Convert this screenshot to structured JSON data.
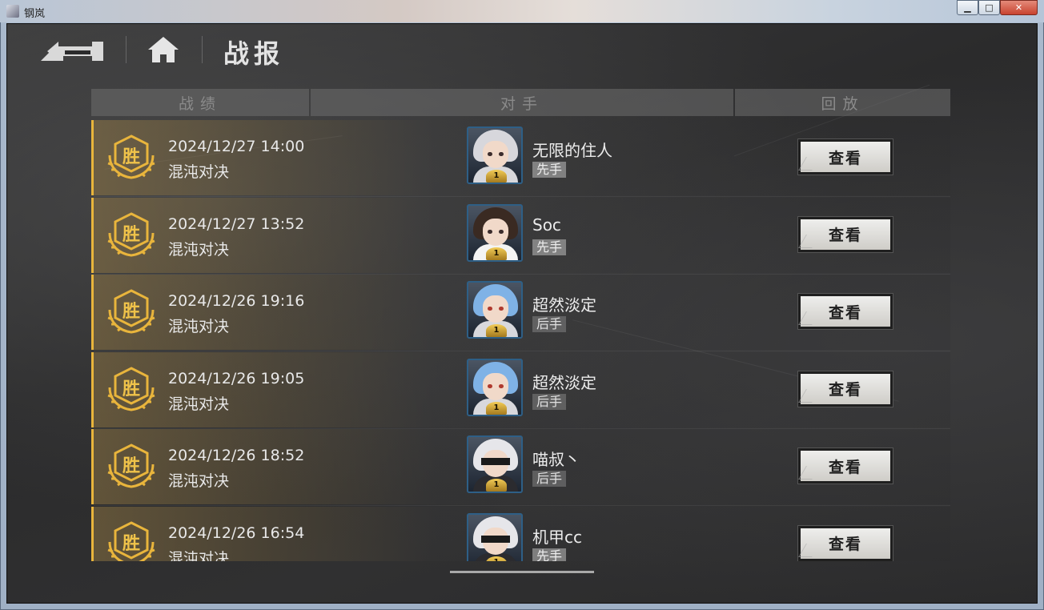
{
  "window": {
    "title": "钢岚",
    "minimize": "▁",
    "maximize": "□",
    "close": "✕"
  },
  "page": {
    "title": "战报"
  },
  "table": {
    "headers": [
      "战绩",
      "对手",
      "回放"
    ],
    "rows": [
      {
        "result": "胜",
        "date": "2024/12/27 14:00",
        "mode": "混沌对决",
        "opponent": "无限的住人",
        "turn": "先手",
        "button": "查看",
        "avatar": "silver-hair"
      },
      {
        "result": "胜",
        "date": "2024/12/27 13:52",
        "mode": "混沌对决",
        "opponent": "Soc",
        "turn": "先手",
        "button": "查看",
        "avatar": "brown-hair"
      },
      {
        "result": "胜",
        "date": "2024/12/26 19:16",
        "mode": "混沌对决",
        "opponent": "超然淡定",
        "turn": "后手",
        "button": "查看",
        "avatar": "blue-hair"
      },
      {
        "result": "胜",
        "date": "2024/12/26 19:05",
        "mode": "混沌对决",
        "opponent": "超然淡定",
        "turn": "后手",
        "button": "查看",
        "avatar": "blue-hair"
      },
      {
        "result": "胜",
        "date": "2024/12/26 18:52",
        "mode": "混沌对决",
        "opponent": "喵叔丶",
        "turn": "后手",
        "button": "查看",
        "avatar": "white-hair-blindfold"
      },
      {
        "result": "胜",
        "date": "2024/12/26 16:54",
        "mode": "混沌对决",
        "opponent": "机甲cc",
        "turn": "先手",
        "button": "查看",
        "avatar": "white-hair-blindfold"
      }
    ]
  },
  "icons": {
    "back": "back-arrow-icon",
    "home": "home-icon",
    "win": "laurel-emblem-icon",
    "rank": "rank-badge-icon"
  },
  "colors": {
    "accent": "#e9b53c",
    "background": "#2e2e2f",
    "button": "#e3e2de"
  }
}
